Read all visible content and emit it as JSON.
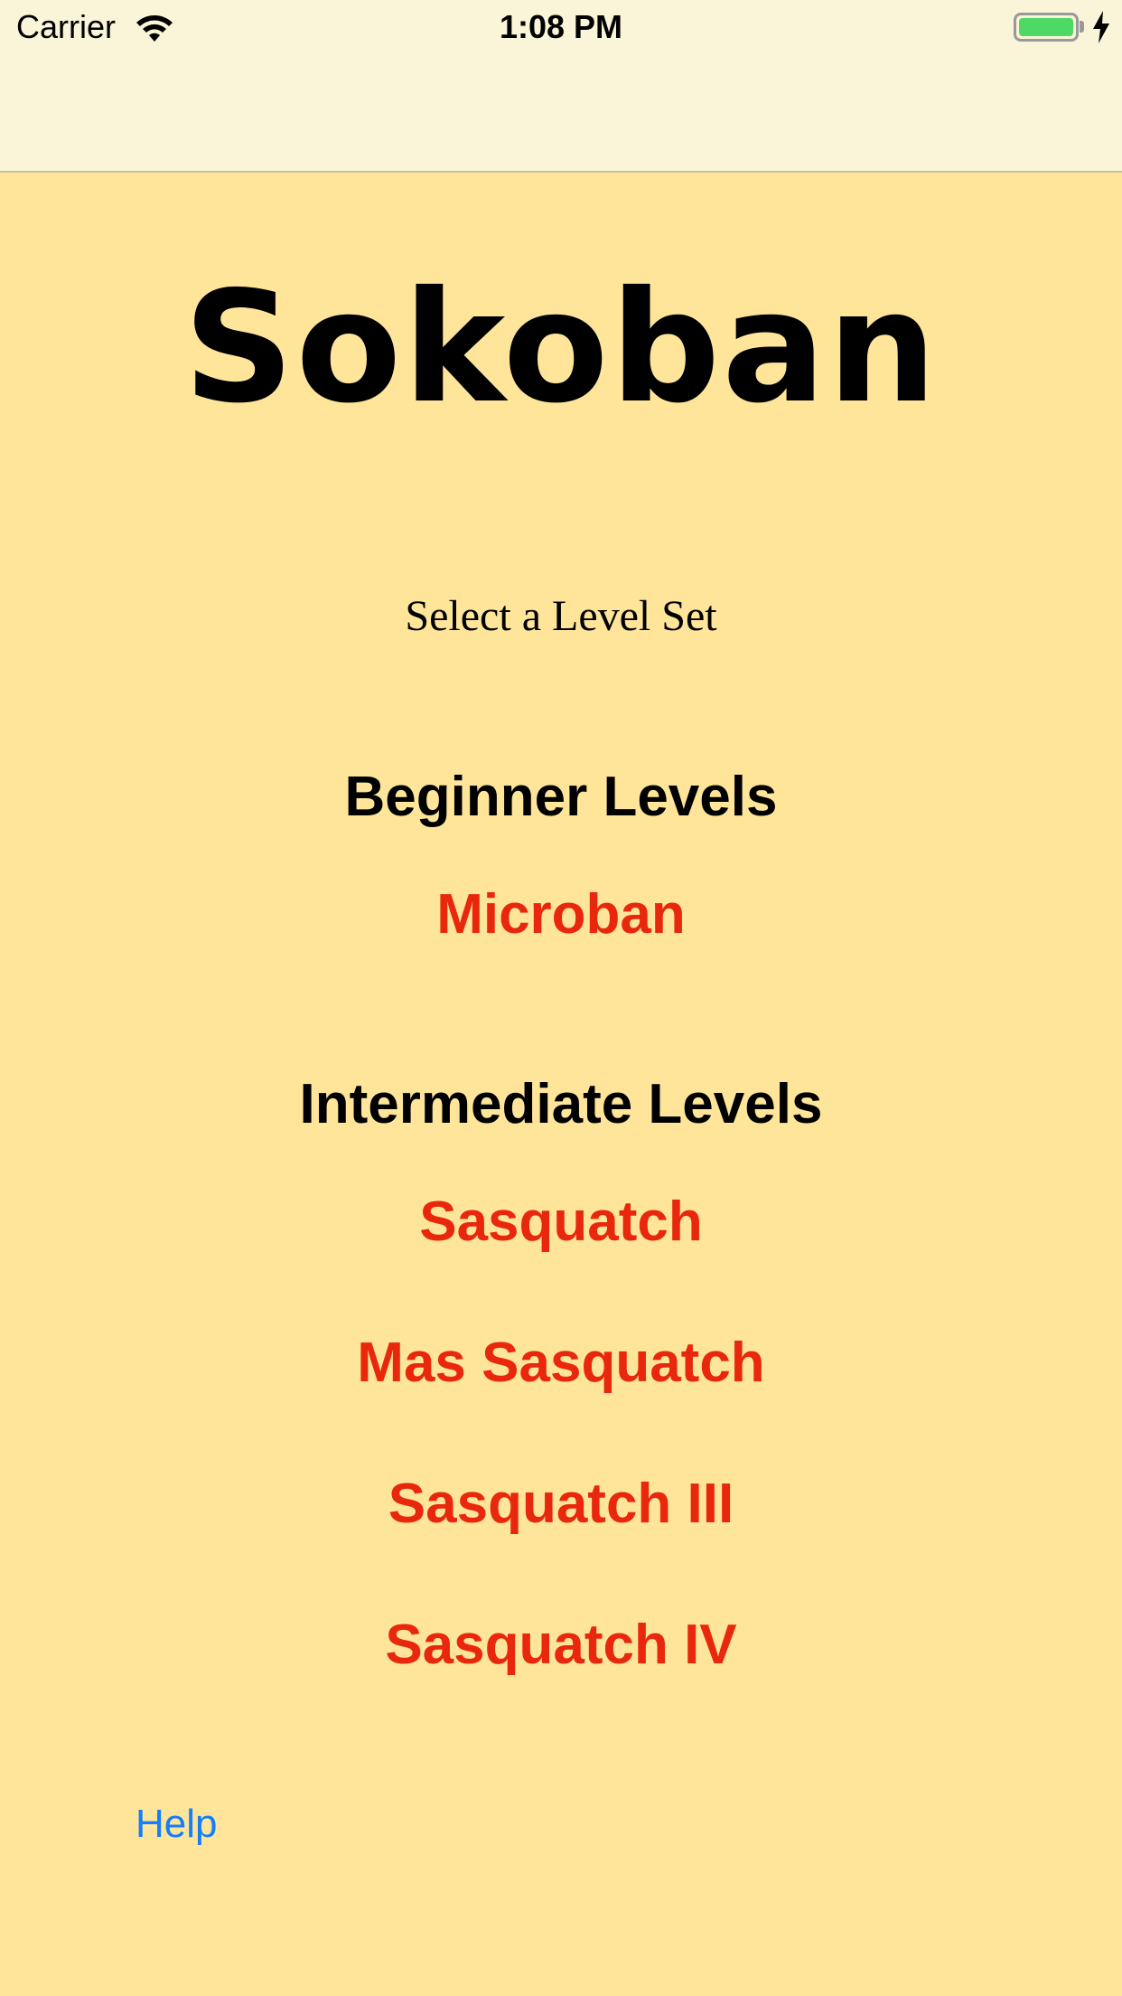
{
  "status_bar": {
    "carrier": "Carrier",
    "time": "1:08 PM",
    "wifi_icon": "wifi-icon",
    "battery_icon": "battery-icon",
    "charging_icon": "charging-bolt-icon",
    "battery_level": 1.0,
    "battery_color": "#4CD964"
  },
  "app": {
    "title": "Sokoban",
    "subtitle": "Select a Level Set"
  },
  "sections": [
    {
      "heading": "Beginner Levels",
      "levels": [
        "Microban"
      ]
    },
    {
      "heading": "Intermediate Levels",
      "levels": [
        "Sasquatch",
        "Mas Sasquatch",
        "Sasquatch III",
        "Sasquatch IV"
      ]
    }
  ],
  "footer": {
    "help_label": "Help"
  },
  "colors": {
    "background": "#FEE59A",
    "nav_bar": "#FAF4D8",
    "level_link": "#E8270C",
    "help_link": "#147EFB"
  }
}
